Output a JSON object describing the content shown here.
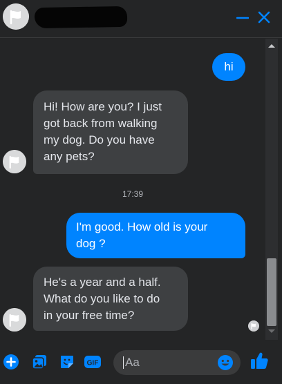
{
  "header": {
    "contact_avatar": "flag-avatar-icon",
    "minimize_icon": "minimize-icon",
    "close_icon": "close-icon",
    "accent_color": "#0084ff"
  },
  "messages": [
    {
      "direction": "outgoing",
      "text": "hi"
    },
    {
      "direction": "incoming",
      "text": "Hi! How are you? I just\ngot back from walking\nmy dog. Do you have\nany pets?"
    },
    {
      "direction": "outgoing",
      "text": "I'm good. How old is your\ndog ?"
    },
    {
      "direction": "incoming",
      "text": "He's a year and a half.\nWhat do you like to do\nin your free time?"
    }
  ],
  "timestamp": "17:39",
  "composer": {
    "placeholder": "Aa",
    "icons": [
      "plus-icon",
      "photo-icon",
      "sticker-icon",
      "gif-icon",
      "emoji-icon",
      "thumbs-up-icon"
    ],
    "gif_label": "GIF"
  },
  "colors": {
    "background": "#242526",
    "outgoing_bubble": "#0084ff",
    "incoming_bubble": "#3e4042",
    "text": "#e4e6eb"
  }
}
